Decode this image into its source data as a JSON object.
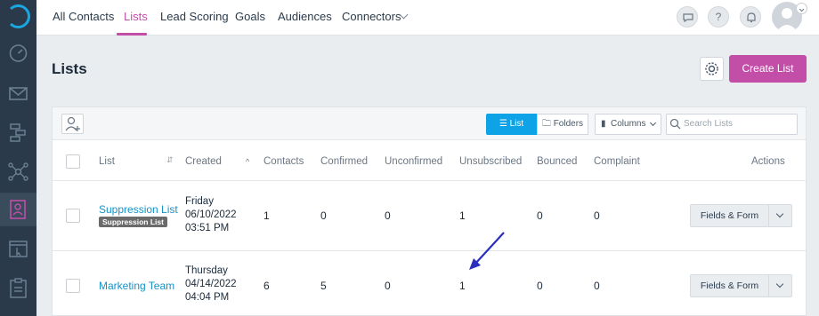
{
  "nav": {
    "tabs": [
      "All Contacts",
      "Lists",
      "Lead Scoring",
      "Goals",
      "Audiences",
      "Connectors"
    ],
    "active_tab": "Lists",
    "icons": [
      "chat-icon",
      "help-icon",
      "notifications-icon"
    ],
    "help_glyph": "?"
  },
  "page": {
    "title": "Lists",
    "create_button": "Create List"
  },
  "toolbar": {
    "view_list": "List",
    "view_folders": "Folders",
    "columns": "Columns",
    "search_placeholder": "Search Lists"
  },
  "table": {
    "headers": [
      "List",
      "Created",
      "Contacts",
      "Confirmed",
      "Unconfirmed",
      "Unsubscribed",
      "Bounced",
      "Complaint",
      "Actions"
    ],
    "rows": [
      {
        "name": "Suppression List",
        "badge": "Suppression List",
        "created_day": "Friday",
        "created_date": "06/10/2022",
        "created_time": "03:51 PM",
        "contacts": "1",
        "confirmed": "0",
        "unconfirmed": "0",
        "unsubscribed": "1",
        "bounced": "0",
        "complaint": "0",
        "action": "Fields & Form"
      },
      {
        "name": "Marketing Team",
        "created_day": "Thursday",
        "created_date": "04/14/2022",
        "created_time": "04:04 PM",
        "contacts": "6",
        "confirmed": "5",
        "unconfirmed": "0",
        "unsubscribed": "1",
        "bounced": "0",
        "complaint": "0",
        "action": "Fields & Form"
      }
    ]
  },
  "colors": {
    "accent": "#c24ea8",
    "primary_blue": "#0ea3e6",
    "link": "#1592c8",
    "rail": "#2b3a4a",
    "arrow": "#2a2fbf"
  }
}
